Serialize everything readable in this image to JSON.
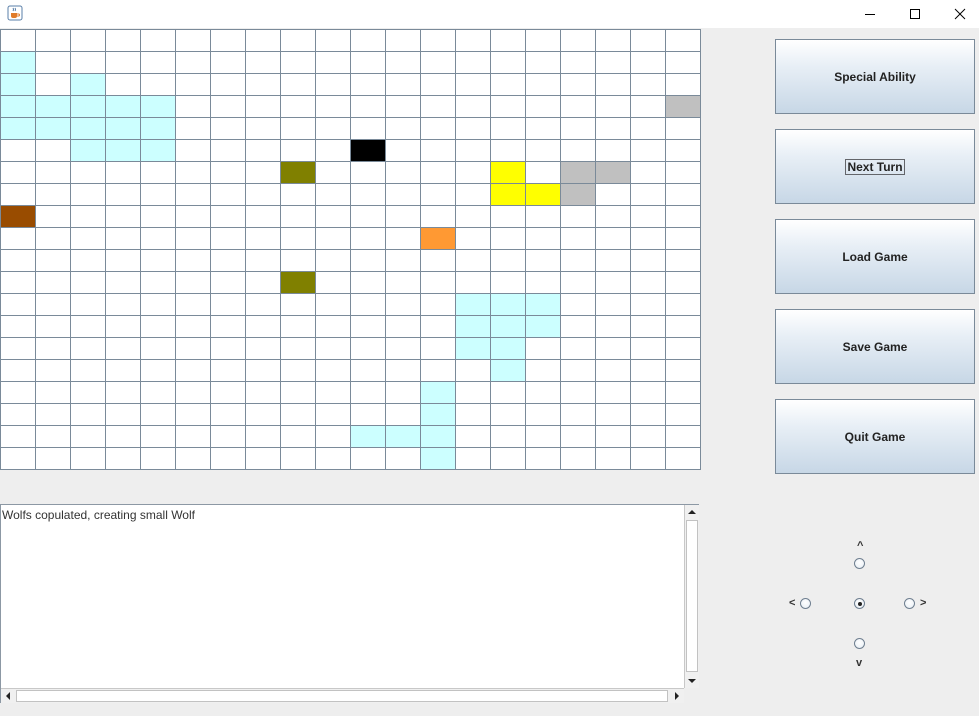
{
  "window": {
    "title_icon": "java-cup-icon",
    "controls": [
      "minimize",
      "maximize",
      "close"
    ]
  },
  "board": {
    "columns": 20,
    "rows": 20,
    "empty_color": "#ffffff",
    "grid_color": "#7a8a99",
    "colored_cells": [
      {
        "r": 1,
        "c": 0,
        "color": "#ccffff"
      },
      {
        "r": 2,
        "c": 0,
        "color": "#ccffff"
      },
      {
        "r": 2,
        "c": 2,
        "color": "#ccffff"
      },
      {
        "r": 3,
        "c": 0,
        "color": "#ccffff"
      },
      {
        "r": 3,
        "c": 1,
        "color": "#ccffff"
      },
      {
        "r": 3,
        "c": 2,
        "color": "#ccffff"
      },
      {
        "r": 3,
        "c": 3,
        "color": "#ccffff"
      },
      {
        "r": 3,
        "c": 4,
        "color": "#ccffff"
      },
      {
        "r": 3,
        "c": 19,
        "color": "#c0c0c0"
      },
      {
        "r": 4,
        "c": 0,
        "color": "#ccffff"
      },
      {
        "r": 4,
        "c": 1,
        "color": "#ccffff"
      },
      {
        "r": 4,
        "c": 2,
        "color": "#ccffff"
      },
      {
        "r": 4,
        "c": 3,
        "color": "#ccffff"
      },
      {
        "r": 4,
        "c": 4,
        "color": "#ccffff"
      },
      {
        "r": 5,
        "c": 2,
        "color": "#ccffff"
      },
      {
        "r": 5,
        "c": 3,
        "color": "#ccffff"
      },
      {
        "r": 5,
        "c": 4,
        "color": "#ccffff"
      },
      {
        "r": 5,
        "c": 10,
        "color": "#000000"
      },
      {
        "r": 6,
        "c": 8,
        "color": "#808000"
      },
      {
        "r": 6,
        "c": 14,
        "color": "#ffff00"
      },
      {
        "r": 6,
        "c": 16,
        "color": "#c0c0c0"
      },
      {
        "r": 6,
        "c": 17,
        "color": "#c0c0c0"
      },
      {
        "r": 7,
        "c": 14,
        "color": "#ffff00"
      },
      {
        "r": 7,
        "c": 15,
        "color": "#ffff00"
      },
      {
        "r": 7,
        "c": 16,
        "color": "#c0c0c0"
      },
      {
        "r": 8,
        "c": 0,
        "color": "#994c00"
      },
      {
        "r": 9,
        "c": 12,
        "color": "#ff9933"
      },
      {
        "r": 11,
        "c": 8,
        "color": "#808000"
      },
      {
        "r": 12,
        "c": 13,
        "color": "#ccffff"
      },
      {
        "r": 12,
        "c": 14,
        "color": "#ccffff"
      },
      {
        "r": 12,
        "c": 15,
        "color": "#ccffff"
      },
      {
        "r": 13,
        "c": 13,
        "color": "#ccffff"
      },
      {
        "r": 13,
        "c": 14,
        "color": "#ccffff"
      },
      {
        "r": 13,
        "c": 15,
        "color": "#ccffff"
      },
      {
        "r": 14,
        "c": 13,
        "color": "#ccffff"
      },
      {
        "r": 14,
        "c": 14,
        "color": "#ccffff"
      },
      {
        "r": 15,
        "c": 14,
        "color": "#ccffff"
      },
      {
        "r": 16,
        "c": 12,
        "color": "#ccffff"
      },
      {
        "r": 17,
        "c": 12,
        "color": "#ccffff"
      },
      {
        "r": 18,
        "c": 10,
        "color": "#ccffff"
      },
      {
        "r": 18,
        "c": 11,
        "color": "#ccffff"
      },
      {
        "r": 18,
        "c": 12,
        "color": "#ccffff"
      },
      {
        "r": 19,
        "c": 12,
        "color": "#ccffff"
      }
    ]
  },
  "buttons": {
    "special_ability": "Special Ability",
    "next_turn": "Next Turn",
    "load_game": "Load Game",
    "save_game": "Save Game",
    "quit_game": "Quit Game"
  },
  "log": {
    "text": "Wolfs copulated, creating small Wolf"
  },
  "direction": {
    "up_label": "^",
    "down_label": "v",
    "left_label": "<",
    "right_label": ">",
    "selected": "center"
  }
}
